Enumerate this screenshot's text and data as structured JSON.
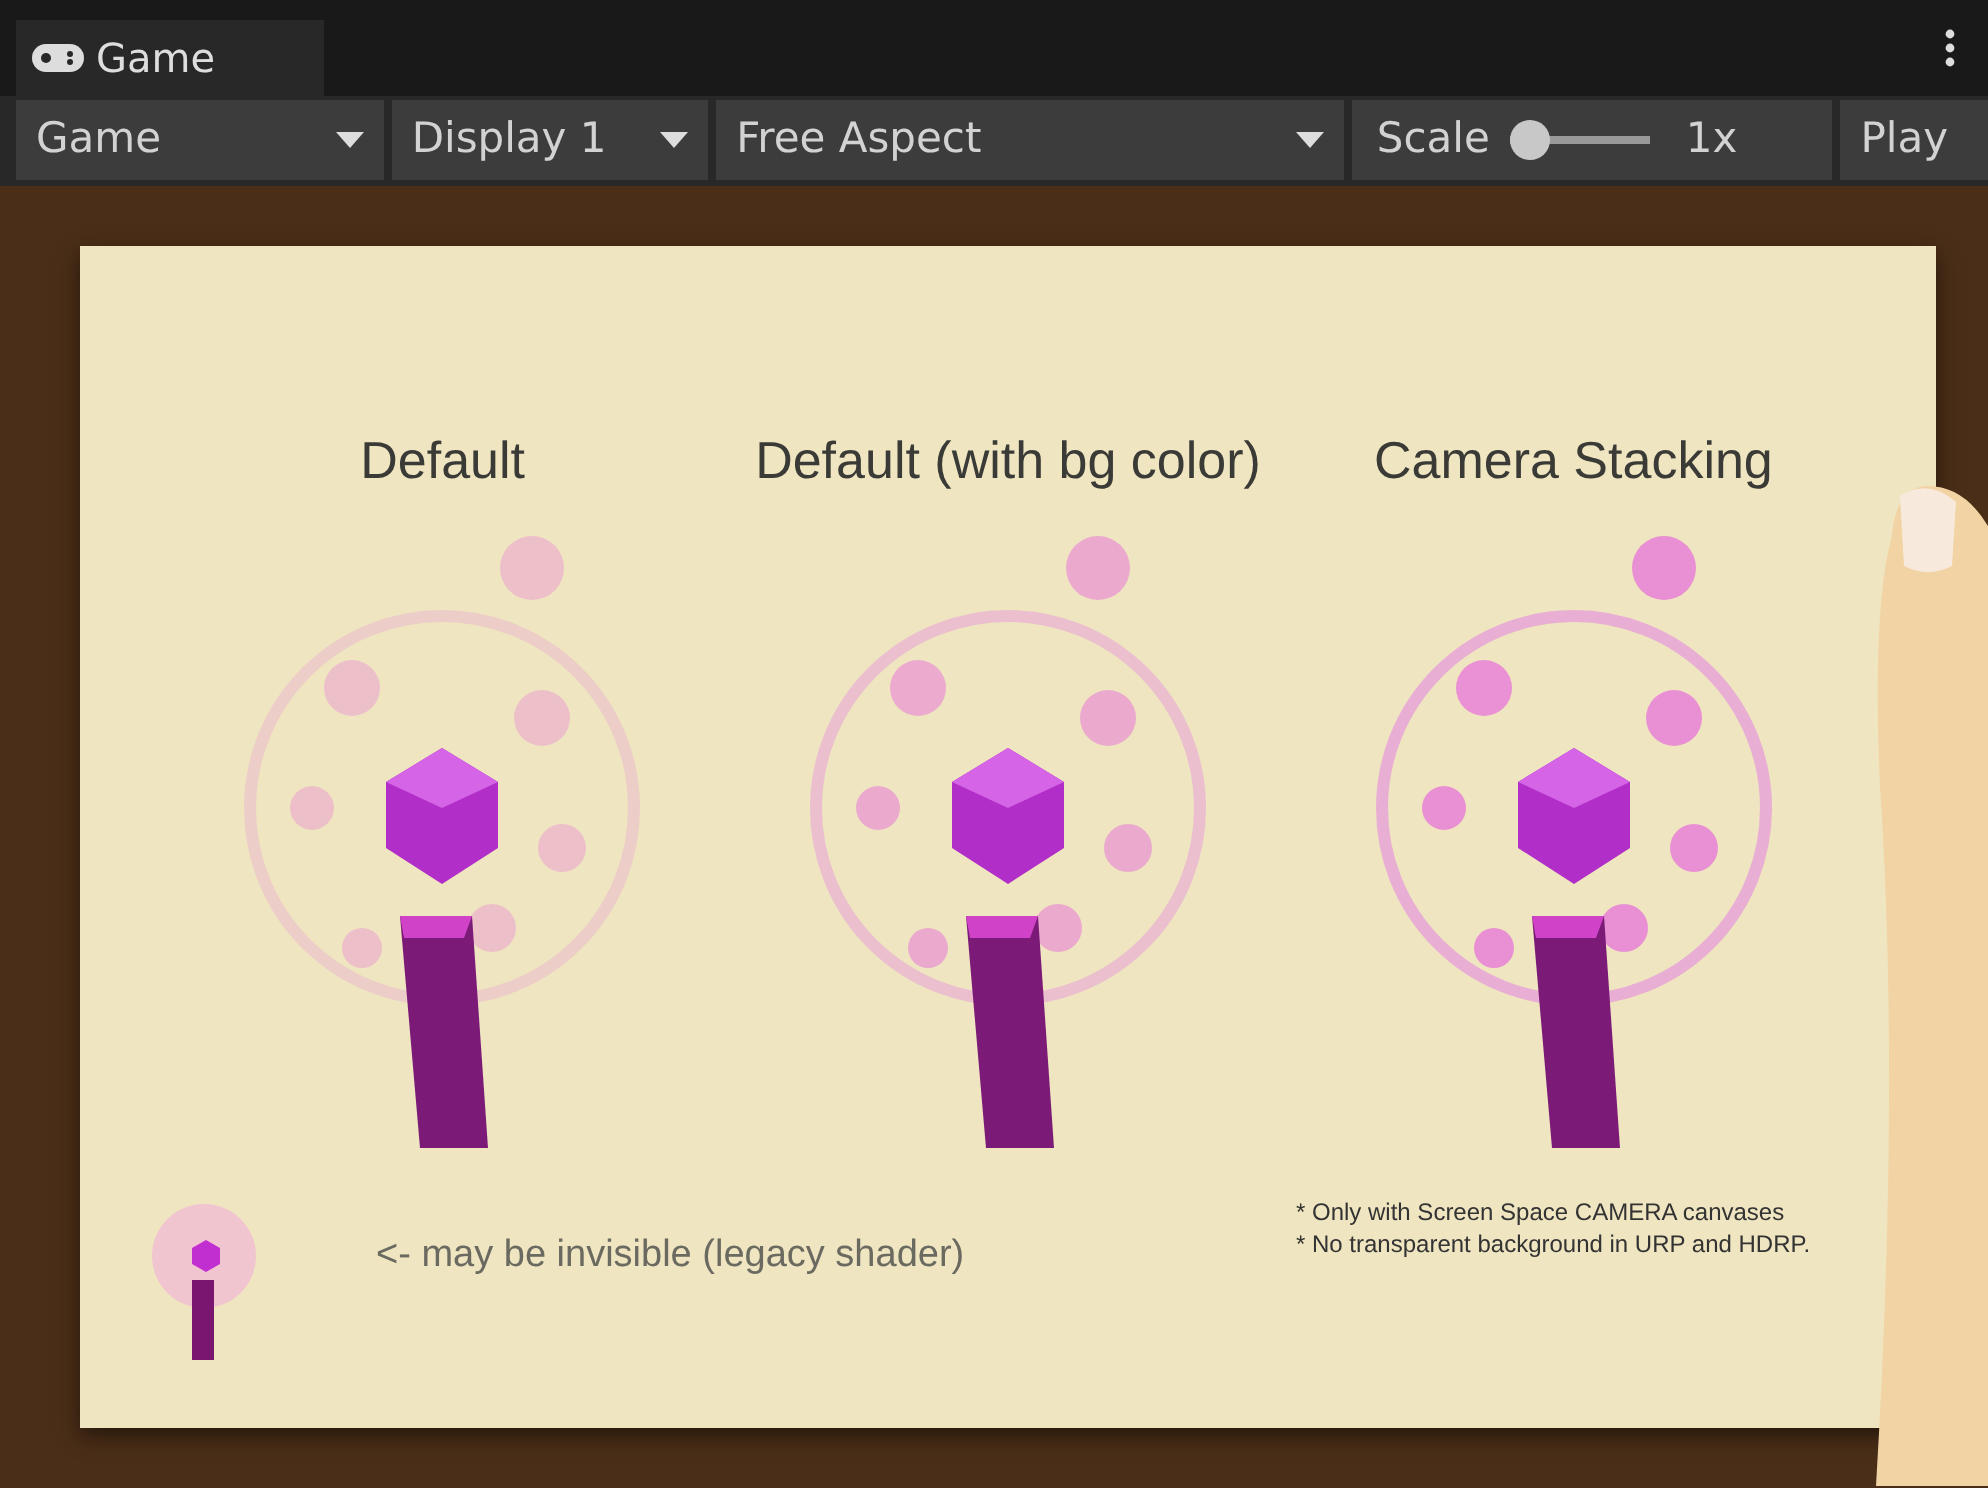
{
  "tab": {
    "title": "Game",
    "selected": true
  },
  "toolbar": [
    {
      "kind": "dropdown",
      "label": "Game"
    },
    {
      "kind": "dropdown",
      "label": "Display 1"
    },
    {
      "kind": "dropdown",
      "label": "Free Aspect"
    },
    {
      "kind": "slider",
      "label": "Scale",
      "level": 0,
      "reading": "1x"
    },
    {
      "kind": "button",
      "label": "Play"
    }
  ],
  "game_view": {
    "columns": [
      {
        "heading": "Default"
      },
      {
        "heading": "Default (with bg color)"
      },
      {
        "heading": "Camera Stacking"
      }
    ],
    "legacy_note": "<- may be invisible (legacy shader)",
    "notes": [
      "* Only with Screen Space CAMERA canvases",
      "* No transparent background in URP and HDRP."
    ]
  }
}
